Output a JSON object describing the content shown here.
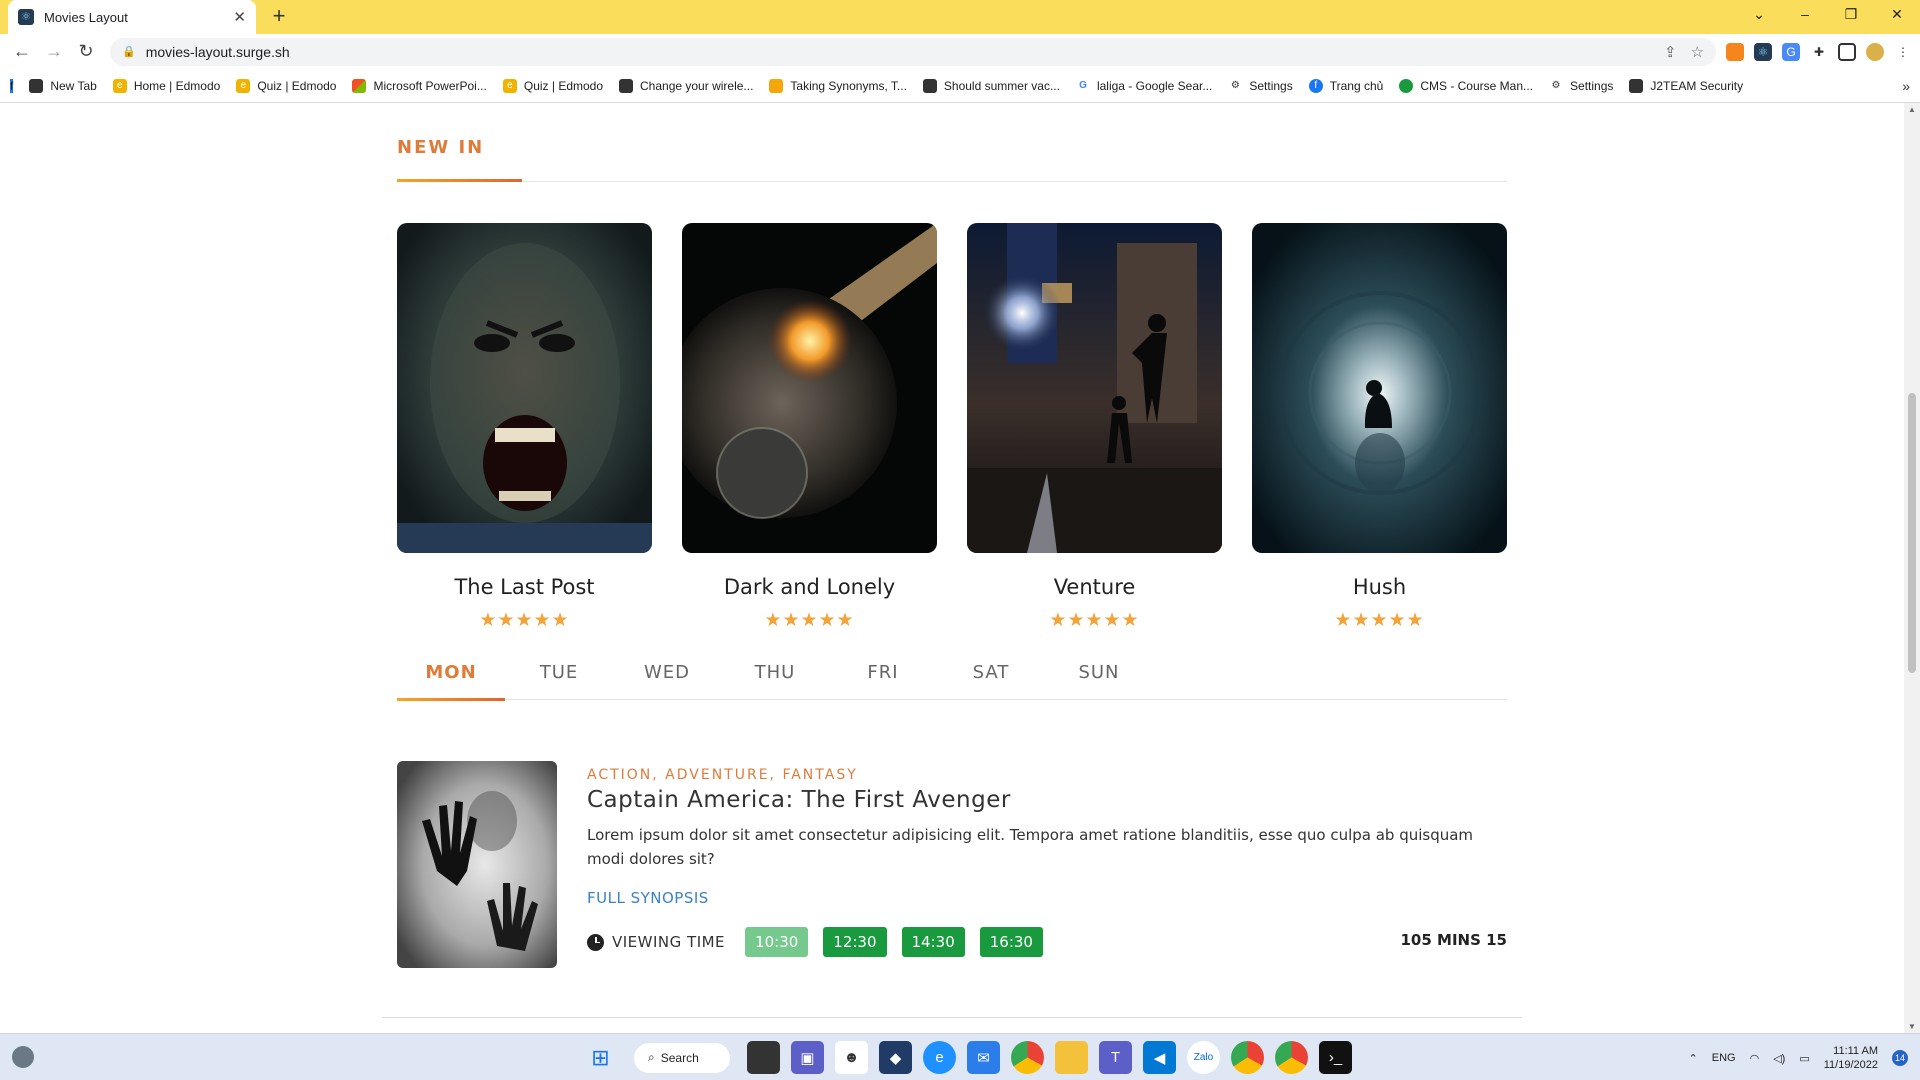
{
  "browser": {
    "tab_title": "Movies Layout",
    "url": "movies-layout.surge.sh",
    "bookmarks": [
      {
        "label": "New Tab",
        "color": "#333"
      },
      {
        "label": "Home | Edmodo",
        "color": "#f0b400"
      },
      {
        "label": "Quiz | Edmodo",
        "color": "#f0b400"
      },
      {
        "label": "Microsoft PowerPoi...",
        "color": "#e64a19"
      },
      {
        "label": "Quiz | Edmodo",
        "color": "#f0b400"
      },
      {
        "label": "Change your wirele...",
        "color": "#333"
      },
      {
        "label": "Taking Synonyms, T...",
        "color": "#f4a70b"
      },
      {
        "label": "Should summer vac...",
        "color": "#333"
      },
      {
        "label": "laliga - Google Sear...",
        "color": "#4285f4"
      },
      {
        "label": "Settings",
        "color": "#333"
      },
      {
        "label": "Trang chủ",
        "color": "#1877f2"
      },
      {
        "label": "CMS - Course Man...",
        "color": "#1a9a3e"
      },
      {
        "label": "Settings",
        "color": "#333"
      },
      {
        "label": "J2TEAM Security",
        "color": "#333"
      }
    ]
  },
  "page": {
    "section_title": "NEW IN",
    "movies": [
      {
        "title": "The Last Post",
        "stars": "★★★★★"
      },
      {
        "title": "Dark and Lonely",
        "stars": "★★★★★"
      },
      {
        "title": "Venture",
        "stars": "★★★★★"
      },
      {
        "title": "Hush",
        "stars": "★★★★★"
      }
    ],
    "days": [
      "MON",
      "TUE",
      "WED",
      "THU",
      "FRI",
      "SAT",
      "SUN"
    ],
    "active_day": "MON",
    "listing": {
      "genres": "ACTION, ADVENTURE, FANTASY",
      "title": "Captain America: The First Avenger",
      "description": "Lorem ipsum dolor sit amet consectetur adipisicing elit. Tempora amet ratione blanditiis, esse quo culpa ab quisquam modi dolores sit?",
      "synopsis_link": "FULL SYNOPSIS",
      "viewing_label": "VIEWING TIME",
      "times": [
        "10:30",
        "12:30",
        "14:30",
        "16:30"
      ],
      "duration": "105 MINS 15"
    },
    "accent_color": "#e07b39",
    "time_color": "#1a9a3e"
  },
  "taskbar": {
    "search_label": "Search",
    "lang": "ENG",
    "time": "11:11 AM",
    "date": "11/19/2022",
    "notifications": "14"
  }
}
